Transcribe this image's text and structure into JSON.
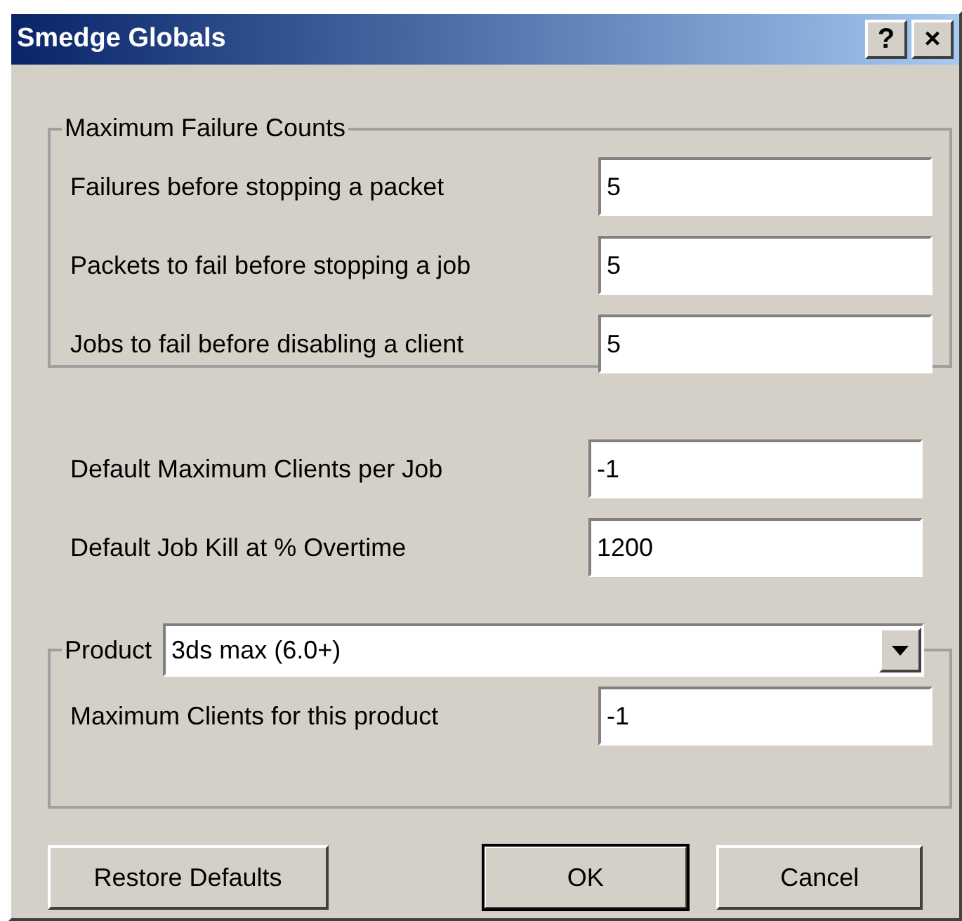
{
  "window": {
    "title": "Smedge Globals",
    "title_buttons": [
      "?",
      "×"
    ]
  },
  "failure_group": {
    "title": "Maximum Failure Counts",
    "fields": [
      {
        "label": "Failures before stopping a packet",
        "value": "5"
      },
      {
        "label": "Packets to fail before stopping a job",
        "value": "5"
      },
      {
        "label": "Jobs to fail before disabling a client",
        "value": "5"
      }
    ]
  },
  "fields": [
    {
      "label": "Default Maximum Clients per Job",
      "value": "-1"
    },
    {
      "label": "Default Job Kill at % Overtime",
      "value": "1200"
    }
  ],
  "product_group": {
    "title": "Product",
    "selected_product": "3ds max (6.0+)",
    "fields": [
      {
        "label": "Maximum Clients for this product",
        "value": "-1"
      }
    ]
  },
  "buttons": [
    {
      "label": "Restore Defaults",
      "default": false
    },
    {
      "label": "OK",
      "default": true
    },
    {
      "label": "Cancel",
      "default": false
    }
  ]
}
